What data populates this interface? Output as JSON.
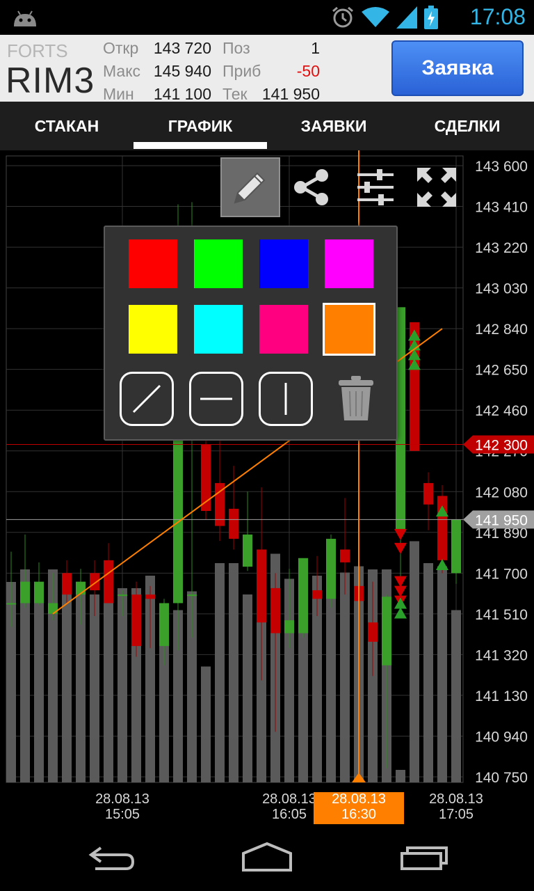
{
  "status_bar": {
    "time": "17:08",
    "icons": [
      "android-icon",
      "alarm-icon",
      "wifi-icon",
      "signal-icon",
      "battery-icon"
    ]
  },
  "header": {
    "exchange": "FORTS",
    "ticker": "RIM3",
    "stats": {
      "open_label": "Откр",
      "open": "143 720",
      "max_label": "Макс",
      "max": "145 940",
      "min_label": "Мин",
      "min": "141 100",
      "pos_label": "Поз",
      "pos": "1",
      "profit_label": "Приб",
      "profit": "-50",
      "cur_label": "Тек",
      "cur": "141 950"
    },
    "order_button": "Заявка"
  },
  "tabs": [
    {
      "label": "СТАКАН",
      "active": false
    },
    {
      "label": "ГРАФИК",
      "active": true
    },
    {
      "label": "ЗАЯВКИ",
      "active": false
    },
    {
      "label": "СДЕЛКИ",
      "active": false
    }
  ],
  "toolbar": {
    "icons": [
      "pencil-icon",
      "share-icon",
      "settings-sliders-icon",
      "fullscreen-icon"
    ],
    "active": "pencil-icon"
  },
  "palette": {
    "colors": [
      "#ff0000",
      "#00ff00",
      "#0000ff",
      "#ff00ff",
      "#ffff00",
      "#00ffff",
      "#ff0080",
      "#ff8000"
    ],
    "selected": "#ff8000",
    "line_tools": [
      "diagonal-line-icon",
      "horizontal-line-icon",
      "vertical-line-icon"
    ],
    "delete_icon": "trash-icon"
  },
  "chart_data": {
    "type": "candlestick",
    "y_ticks": [
      "143 600",
      "143 410",
      "143 220",
      "143 030",
      "142 840",
      "142 650",
      "142 460",
      "142 270",
      "142 080",
      "141 890",
      "141 700",
      "141 510",
      "141 320",
      "141 130",
      "140 940",
      "140 750"
    ],
    "ylim": [
      140750,
      143600
    ],
    "x_ticks": [
      {
        "date": "28.08.13",
        "time": "15:05"
      },
      {
        "date": "28.08.13",
        "time": "16:05"
      },
      {
        "date": "28.08.13",
        "time": "17:05"
      }
    ],
    "crosshair": {
      "date": "28.08.13",
      "time": "16:30",
      "color": "#ff8000"
    },
    "price_markers": [
      {
        "label": "142 300",
        "value": 142300,
        "color": "#c00000"
      },
      {
        "label": "141 950",
        "value": 141950,
        "color": "#a0a0a0"
      }
    ],
    "trend_line": {
      "from": {
        "index": 3,
        "value": 141510
      },
      "to": {
        "index": 31,
        "value": 142840
      },
      "color": "#ff8000"
    },
    "candles": [
      {
        "o": 141560,
        "h": 141800,
        "l": 141450,
        "c": 141560,
        "v": 0.64
      },
      {
        "o": 141560,
        "h": 141880,
        "l": 141540,
        "c": 141660,
        "v": 0.68
      },
      {
        "o": 141560,
        "h": 141750,
        "l": 141550,
        "c": 141660,
        "v": 0.63
      },
      {
        "o": 141510,
        "h": 141700,
        "l": 141480,
        "c": 141560,
        "v": 0.68
      },
      {
        "o": 141700,
        "h": 141760,
        "l": 141560,
        "c": 141600,
        "v": 0.6
      },
      {
        "o": 141600,
        "h": 141720,
        "l": 141460,
        "c": 141660,
        "v": 0.64
      },
      {
        "o": 141700,
        "h": 141760,
        "l": 141500,
        "c": 141620,
        "v": 0.6
      },
      {
        "o": 141760,
        "h": 141840,
        "l": 141560,
        "c": 141560,
        "v": 0.59
      },
      {
        "o": 141600,
        "h": 141620,
        "l": 141500,
        "c": 141600,
        "v": 0.62
      },
      {
        "o": 141600,
        "h": 141660,
        "l": 141310,
        "c": 141360,
        "v": 0.62
      },
      {
        "o": 141600,
        "h": 141640,
        "l": 141350,
        "c": 141580,
        "v": 0.66
      },
      {
        "o": 141360,
        "h": 141580,
        "l": 141270,
        "c": 141560,
        "v": 0.5
      },
      {
        "o": 141560,
        "h": 143420,
        "l": 141340,
        "c": 142350,
        "v": 0.55
      },
      {
        "o": 141600,
        "h": 143430,
        "l": 141400,
        "c": 141600,
        "v": 0.61
      },
      {
        "o": 142300,
        "h": 142340,
        "l": 141950,
        "c": 141990,
        "v": 0.37
      },
      {
        "o": 142120,
        "h": 142350,
        "l": 141850,
        "c": 141920,
        "v": 0.7
      },
      {
        "o": 142000,
        "h": 142200,
        "l": 141810,
        "c": 141860,
        "v": 0.7
      },
      {
        "o": 141730,
        "h": 142080,
        "l": 141710,
        "c": 141880,
        "v": 0.6
      },
      {
        "o": 141810,
        "h": 142100,
        "l": 141200,
        "c": 141470,
        "v": 0.7
      },
      {
        "o": 141630,
        "h": 141700,
        "l": 140960,
        "c": 141420,
        "v": 0.73
      },
      {
        "o": 141420,
        "h": 141720,
        "l": 141350,
        "c": 141480,
        "v": 0.65
      },
      {
        "o": 141420,
        "h": 141720,
        "l": 141400,
        "c": 141770,
        "v": 0.71
      },
      {
        "o": 141620,
        "h": 141780,
        "l": 141500,
        "c": 141580,
        "v": 0.66
      },
      {
        "o": 141580,
        "h": 141880,
        "l": 141540,
        "c": 141860,
        "v": 0.66
      },
      {
        "o": 141810,
        "h": 142050,
        "l": 141600,
        "c": 141750,
        "v": 0.67
      },
      {
        "o": 141640,
        "h": 141760,
        "l": 141320,
        "c": 141570,
        "v": 0.69
      },
      {
        "o": 141470,
        "h": 141660,
        "l": 141220,
        "c": 141380,
        "v": 0.68
      },
      {
        "o": 141270,
        "h": 141600,
        "l": 140790,
        "c": 141590,
        "v": 0.68
      },
      {
        "o": 141900,
        "h": 142900,
        "l": 141500,
        "c": 142940,
        "v": 0.04
      },
      {
        "o": 142870,
        "h": 142870,
        "l": 142270,
        "c": 142270,
        "v": 0.77
      },
      {
        "o": 142120,
        "h": 142170,
        "l": 141900,
        "c": 142020,
        "v": 0.7
      },
      {
        "o": 142060,
        "h": 142110,
        "l": 141700,
        "c": 141760,
        "v": 0.69
      },
      {
        "o": 141700,
        "h": 141950,
        "l": 141650,
        "c": 141950,
        "v": 0.55
      }
    ]
  },
  "navbar": {
    "icons": [
      "back-icon",
      "home-icon",
      "recent-apps-icon"
    ]
  }
}
